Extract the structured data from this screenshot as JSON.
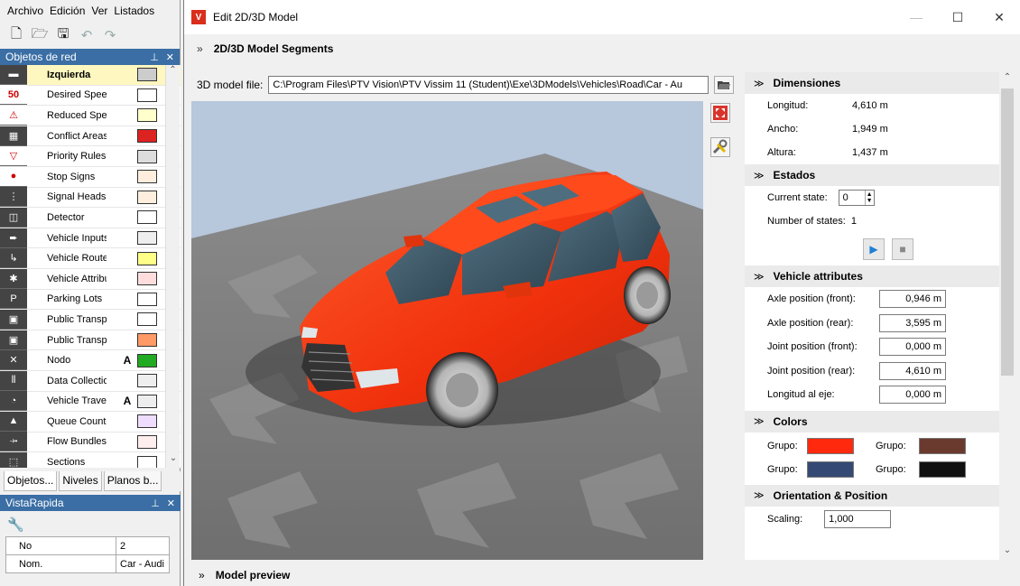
{
  "app": {
    "menu": [
      "Archivo",
      "Edición",
      "Ver",
      "Listados"
    ],
    "objects_panel_title": "Objetos de red",
    "objects": [
      {
        "label": "Izquierda",
        "icon": "road-icon",
        "icon_text": "▬",
        "swatch": "#cccccc",
        "flag": "",
        "selected": true
      },
      {
        "label": "Desired Speed",
        "icon": "speed-50-icon",
        "icon_text": "50",
        "swatch": "#ffffff",
        "flag": ""
      },
      {
        "label": "Reduced Spee",
        "icon": "reduced-speed-icon",
        "icon_text": "⚠",
        "swatch": "#ffffcc",
        "flag": ""
      },
      {
        "label": "Conflict Areas",
        "icon": "conflict-areas-icon",
        "icon_text": "▦",
        "swatch": "#dd2222",
        "flag": ""
      },
      {
        "label": "Priority Rules",
        "icon": "priority-rules-icon",
        "icon_text": "▽",
        "swatch": "#dddddd",
        "flag": ""
      },
      {
        "label": "Stop Signs",
        "icon": "stop-sign-icon",
        "icon_text": "●",
        "swatch": "#ffeedd",
        "flag": ""
      },
      {
        "label": "Signal Heads",
        "icon": "signal-head-icon",
        "icon_text": "⋮",
        "swatch": "#ffeedd",
        "flag": ""
      },
      {
        "label": "Detector",
        "icon": "detector-icon",
        "icon_text": "◫",
        "swatch": "#ffffff",
        "flag": ""
      },
      {
        "label": "Vehicle Inputs",
        "icon": "vehicle-input-icon",
        "icon_text": "➨",
        "swatch": "#eeeeee",
        "flag": ""
      },
      {
        "label": "Vehicle Routes",
        "icon": "vehicle-routes-icon",
        "icon_text": "↳",
        "swatch": "#ffff88",
        "flag": ""
      },
      {
        "label": "Vehicle Attribu",
        "icon": "vehicle-attr-icon",
        "icon_text": "✱",
        "swatch": "#ffdddd",
        "flag": ""
      },
      {
        "label": "Parking Lots",
        "icon": "parking-icon",
        "icon_text": "P",
        "swatch": "#ffffff",
        "flag": ""
      },
      {
        "label": "Public Transpo",
        "icon": "pt-stop-icon",
        "icon_text": "▣",
        "swatch": "#ffffff",
        "flag": ""
      },
      {
        "label": "Public Transpo",
        "icon": "pt-line-icon",
        "icon_text": "▣",
        "swatch": "#ff9966",
        "flag": ""
      },
      {
        "label": "Nodo",
        "icon": "node-icon",
        "icon_text": "✕",
        "swatch": "#22aa22",
        "flag": "A"
      },
      {
        "label": "Data Collectio",
        "icon": "data-collection-icon",
        "icon_text": "⦀",
        "swatch": "#eeeeee",
        "flag": ""
      },
      {
        "label": "Vehicle Travel",
        "icon": "vehicle-travel-icon",
        "icon_text": "◔",
        "swatch": "#eeeeee",
        "flag": "A"
      },
      {
        "label": "Queue Counte",
        "icon": "queue-counter-icon",
        "icon_text": "▲",
        "swatch": "#eeddff",
        "flag": ""
      },
      {
        "label": "Flow Bundles",
        "icon": "flow-bundles-icon",
        "icon_text": "⤞",
        "swatch": "#ffeeee",
        "flag": ""
      },
      {
        "label": "Sections",
        "icon": "sections-icon",
        "icon_text": "⬚",
        "swatch": "#ffffff",
        "flag": ""
      }
    ],
    "left_tabs": [
      "Objetos...",
      "Niveles",
      "Planos b..."
    ],
    "quickview_title": "VistaRapida",
    "quickview_rows": [
      {
        "key": "No",
        "value": "2"
      },
      {
        "key": "Nom.",
        "value": "Car - Audi"
      }
    ]
  },
  "dialog": {
    "title": "Edit 2D/3D Model",
    "segments_label": "2D/3D Model Segments",
    "file_label": "3D model file:",
    "file_path": "C:\\Program Files\\PTV Vision\\PTV Vissim 11 (Student)\\Exe\\3DModels\\Vehicles\\Road\\Car - Au",
    "dimensions": {
      "title": "Dimensiones",
      "rows": [
        {
          "key": "Longitud:",
          "value": "4,610 m"
        },
        {
          "key": "Ancho:",
          "value": "1,949 m"
        },
        {
          "key": "Altura:",
          "value": "1,437 m"
        }
      ]
    },
    "states": {
      "title": "Estados",
      "current_label": "Current state:",
      "current_value": "0",
      "number_label": "Number of states:",
      "number_value": "1"
    },
    "vehicle_attributes": {
      "title": "Vehicle attributes",
      "rows": [
        {
          "key": "Axle position (front):",
          "value": "0,946 m"
        },
        {
          "key": "Axle position (rear):",
          "value": "3,595 m"
        },
        {
          "key": "Joint position (front):",
          "value": "0,000 m"
        },
        {
          "key": "Joint position (rear):",
          "value": "4,610 m"
        },
        {
          "key": "Longitud al eje:",
          "value": "0,000 m"
        }
      ]
    },
    "colors": {
      "title": "Colors",
      "items": [
        {
          "label": "Grupo:",
          "color": "#ff2a0e"
        },
        {
          "label": "Grupo:",
          "color": "#6b3a2e"
        },
        {
          "label": "Grupo:",
          "color": "#344a74"
        },
        {
          "label": "Grupo:",
          "color": "#111111"
        }
      ]
    },
    "orientation": {
      "title": "Orientation & Position",
      "scaling_label": "Scaling:",
      "scaling_value": "1,000"
    },
    "preview_label": "Model preview"
  }
}
